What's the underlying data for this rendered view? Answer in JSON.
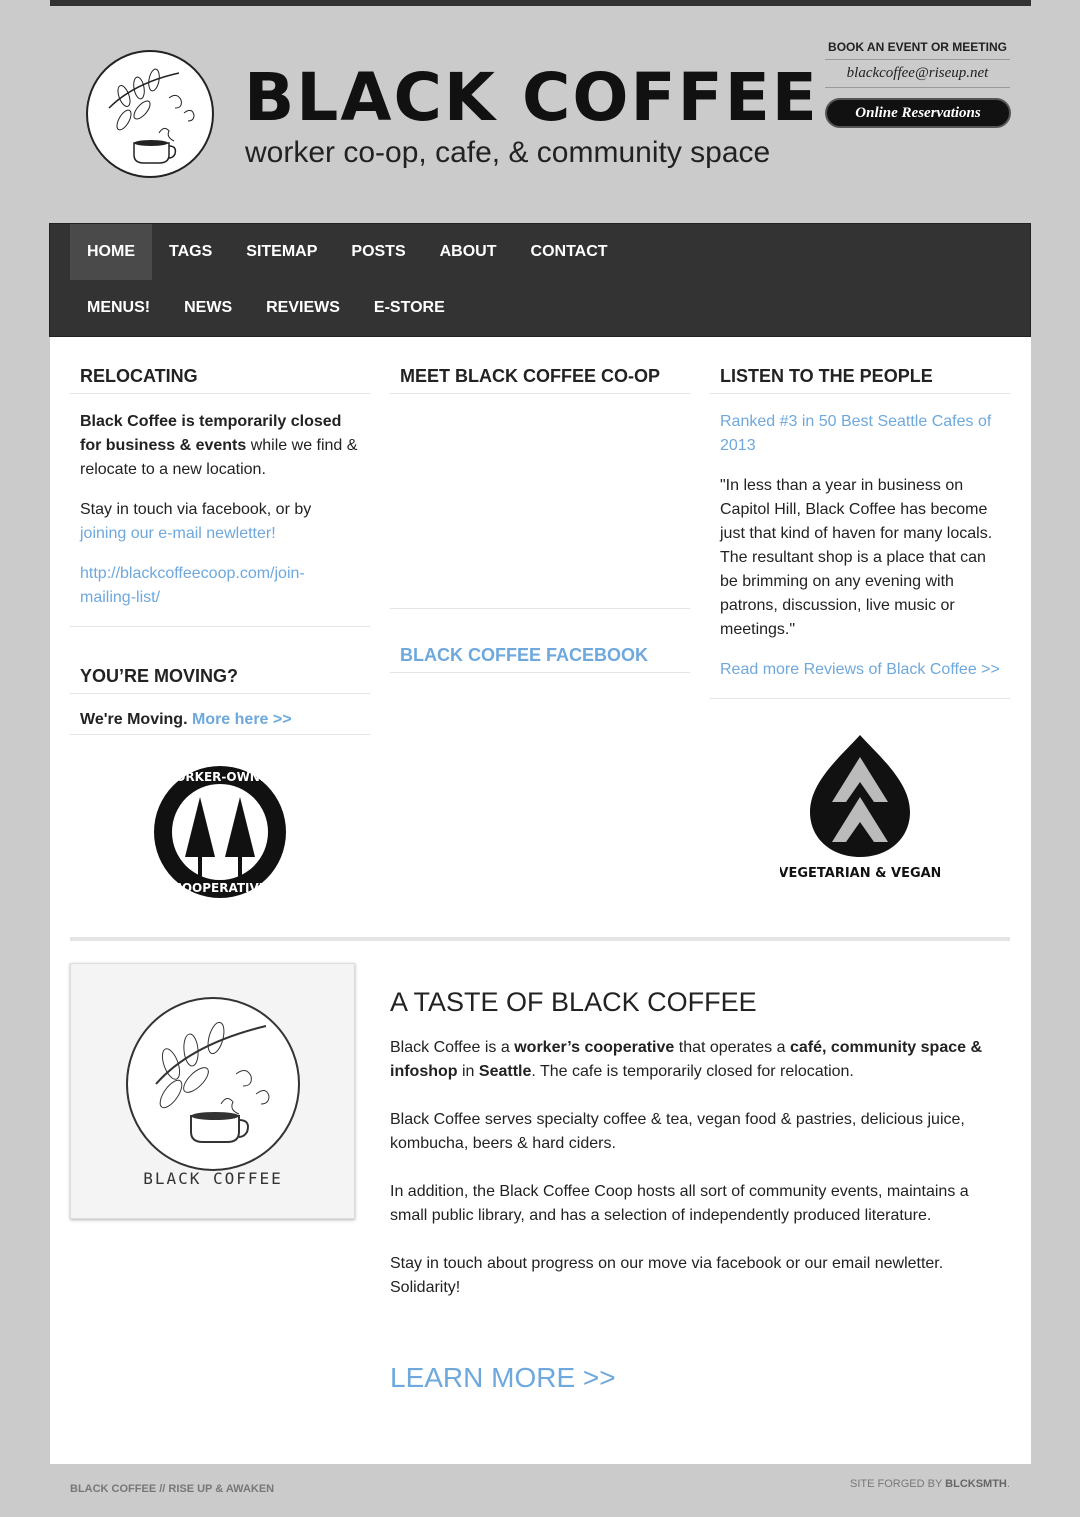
{
  "header": {
    "brand": "BLACK COFFEE",
    "tagline": "worker co-op, cafe, & community space",
    "book_title": "BOOK AN EVENT OR MEETING",
    "book_email": "blackcoffee@riseup.net",
    "reserve_label": "Online Reservations"
  },
  "nav": {
    "row1": [
      "HOME",
      "TAGS",
      "SITEMAP",
      "POSTS",
      "ABOUT",
      "CONTACT"
    ],
    "row2": [
      "MENUS!",
      "NEWS",
      "REVIEWS",
      "E-STORE"
    ]
  },
  "relocating": {
    "title": "RELOCATING",
    "bold": "Black Coffee is temporarily closed for business & events",
    "text": " while we find & relocate to a new location.",
    "stay": "Stay in touch via facebook, or by ",
    "join_link": "joining our e-mail newletter!",
    "url": "http://blackcoffeecoop.com/join-mailing-list/"
  },
  "moving": {
    "title": "YOU’RE MOVING?",
    "text": "We're Moving. ",
    "link": "More here >>"
  },
  "meet": {
    "title": "MEET BLACK COFFEE CO-OP",
    "facebook": "BLACK COFFEE FACEBOOK"
  },
  "listen": {
    "title": "LISTEN TO THE PEOPLE",
    "ranked": "Ranked #3 in 50 Best Seattle Cafes of 2013",
    "quote": "\"In less than a year in business on Capitol Hill, Black Coffee has become just that kind of haven for many locals. The resultant shop is a place that can be brimming on any evening with patrons, discussion, live music or meetings.\"",
    "read_more": "Read more Reviews of Black Coffee >>"
  },
  "badges": {
    "coop_top": "WORKER-OWNED",
    "coop_bottom": "COOPERATIVE",
    "veg": "VEGETARIAN & VEGAN"
  },
  "taste": {
    "title": "A TASTE OF BLACK COFFEE",
    "p1_a": "Black Coffee is a ",
    "p1_b": "worker’s cooperative",
    "p1_c": " that operates a ",
    "p1_d": "café, community space & infoshop",
    "p1_e": " in ",
    "p1_f": "Seattle",
    "p1_g": ". The cafe is temporarily closed for relocation.",
    "p2": "Black Coffee serves specialty coffee & tea, vegan food & pastries, delicious juice, kombucha, beers & hard ciders.",
    "p3": "In addition, the Black Coffee Coop hosts all sort of community events, maintains a small public library, and has a selection of independently produced literature.",
    "p4": "Stay in touch about progress on our move via facebook or our email newletter. Solidarity!",
    "learn": "LEARN MORE >>",
    "photo_caption": "BLACK COFFEE"
  },
  "footer": {
    "left": "BLACK COFFEE // RISE UP & AWAKEN",
    "right_a": "SITE FORGED BY ",
    "right_b": "BLCKSMTH",
    "right_c": "."
  }
}
